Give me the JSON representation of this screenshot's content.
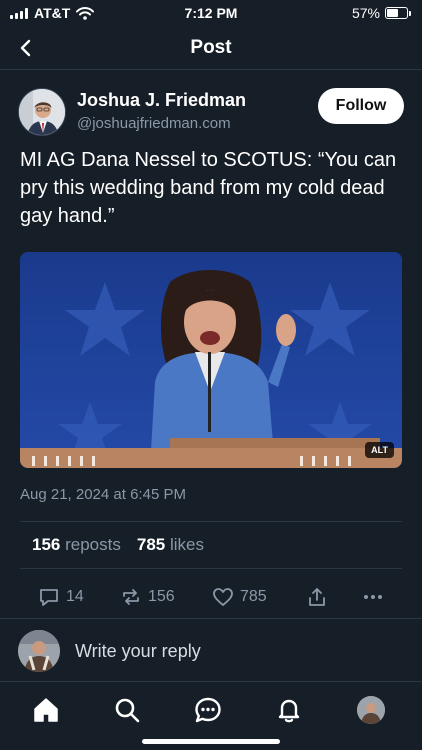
{
  "status_bar": {
    "carrier": "AT&T",
    "time": "7:12 PM",
    "battery": "57%",
    "battery_level": 0.57
  },
  "nav": {
    "title": "Post",
    "back_icon": "chevron-left-icon"
  },
  "post": {
    "author_name": "Joshua J. Friedman",
    "author_handle": "@joshuajfriedman.com",
    "follow_label": "Follow",
    "text": "MI AG Dana Nessel to SCOTUS: “You can pry this wedding band from my cold dead gay hand.”",
    "image_alt_badge": "ALT",
    "timestamp": "Aug 21, 2024 at 6:45 PM",
    "reposts_count": "156",
    "reposts_label": "reposts",
    "likes_count": "785",
    "likes_label": "likes"
  },
  "actions": {
    "reply_count": "14",
    "repost_count": "156",
    "like_count": "785"
  },
  "reply": {
    "placeholder": "Write your reply"
  },
  "tab_bar": {
    "items": [
      "home",
      "search",
      "chat",
      "notifications",
      "profile"
    ]
  },
  "colors": {
    "background": "#161e27",
    "divider": "#2a3644",
    "muted_text": "#8a98a8",
    "follow_bg": "#ffffff"
  }
}
